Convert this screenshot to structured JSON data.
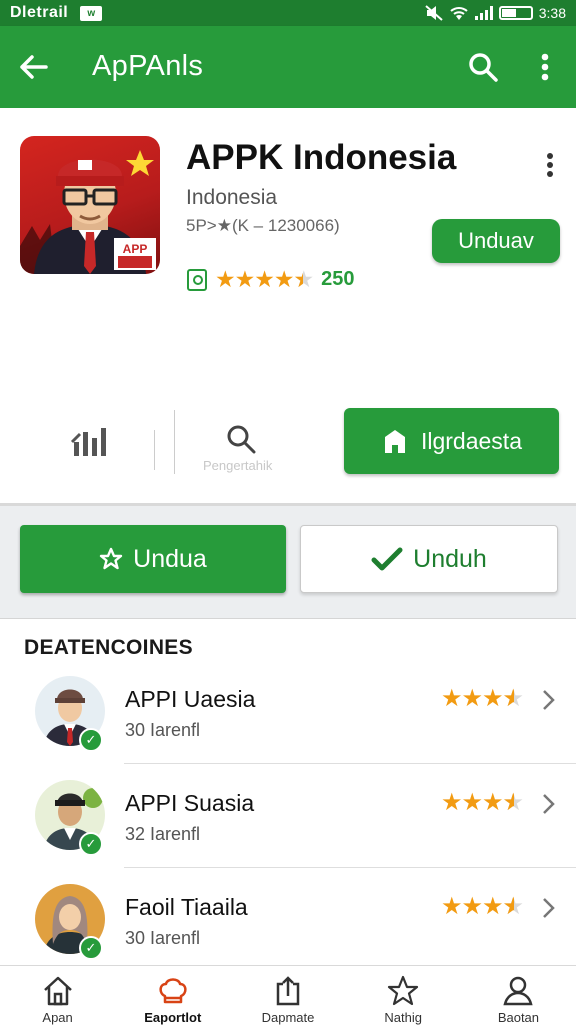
{
  "status_bar": {
    "carrier": "Dletrail",
    "notification": "w",
    "right_text": "3:38"
  },
  "app_bar": {
    "title": "ApPAnls",
    "icons": [
      "back-arrow-icon",
      "search-icon",
      "more-vert-icon"
    ]
  },
  "app": {
    "title": "APPK Indonesia",
    "developer": "Indonesia",
    "meta": "5P>★(K – 1230066)",
    "install_label": "Unduav",
    "rating_stars": 4.5,
    "rating_count": "250"
  },
  "actions": {
    "search_label": "Pengertahik",
    "primary_label": "Ilgrdaesta"
  },
  "buttons": {
    "left_label": "Undua",
    "right_label": "Unduh"
  },
  "list": {
    "section_title": "DEATENCOINES",
    "items": [
      {
        "name": "APPI Uaesia",
        "sub": "30 Iarenfl",
        "rating": 4.5
      },
      {
        "name": "APPI Suasia",
        "sub": "32 Iarenfl",
        "rating": 4.5
      },
      {
        "name": "Faoil Tiaaila",
        "sub": "30 Iarenfl",
        "rating": 4.5
      }
    ]
  },
  "bottom_nav": {
    "items": [
      {
        "label": "Apan",
        "icon": "home-icon",
        "active": false
      },
      {
        "label": "Eaportlot",
        "icon": "chef-hat-icon",
        "active": true
      },
      {
        "label": "Dapmate",
        "icon": "share-icon",
        "active": false
      },
      {
        "label": "Nathig",
        "icon": "star-icon",
        "active": false
      },
      {
        "label": "Baotan",
        "icon": "person-icon",
        "active": false
      }
    ]
  },
  "colors": {
    "primary_green": "#279b3b",
    "status_green": "#1e7e2f",
    "star_orange": "#f29b12",
    "active_nav": "#d84315"
  }
}
